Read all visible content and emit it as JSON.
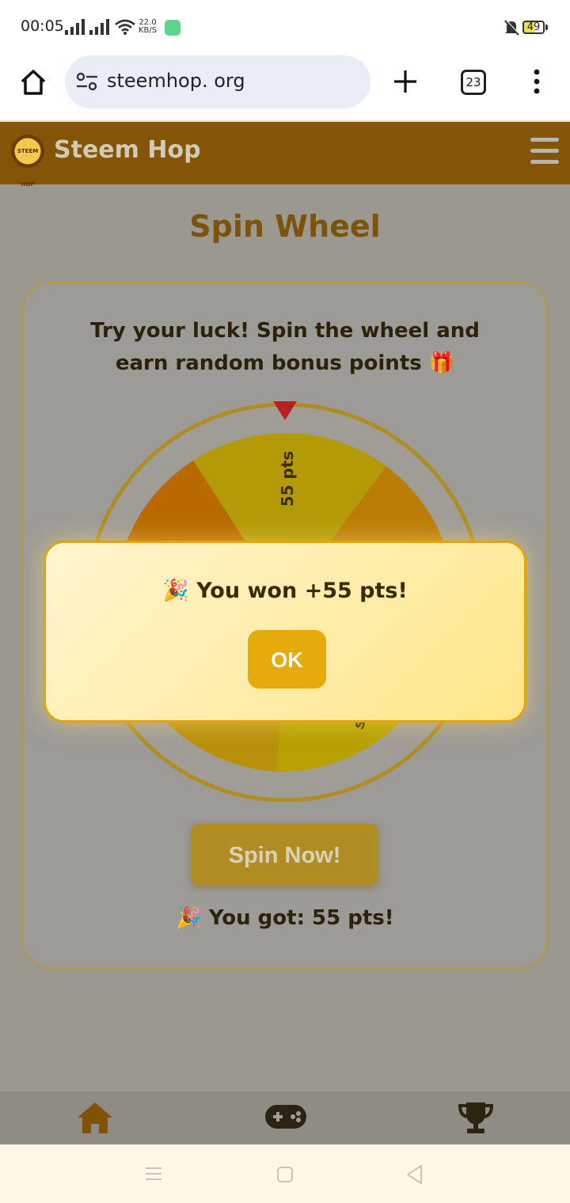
{
  "status_bar": {
    "time": "00:05",
    "speed_value": "22.0",
    "speed_unit": "KB/S",
    "battery": "49"
  },
  "browser": {
    "url": "steemhop. org",
    "tab_count": "23"
  },
  "site_header": {
    "name": "Steem Hop",
    "logo_text": "STEEM HOP"
  },
  "page": {
    "title": "Spin Wheel"
  },
  "card": {
    "intro": "Try your luck! Spin the wheel and earn random bonus points 🎁",
    "wheel_top_label": "55 pts",
    "wheel_partial_label": "s",
    "spin_button": "Spin Now!",
    "result": "🎉 You got: 55 pts!"
  },
  "modal": {
    "message": "🎉 You won +55 pts!",
    "ok_label": "OK"
  },
  "bottom_nav": {
    "items": [
      "home-icon",
      "gamepad-icon",
      "trophy-icon"
    ]
  },
  "colors": {
    "accent": "#e5ab0b",
    "header_brown": "#845506",
    "title_brown": "#7d520a",
    "modal_border": "#e2a30c"
  }
}
